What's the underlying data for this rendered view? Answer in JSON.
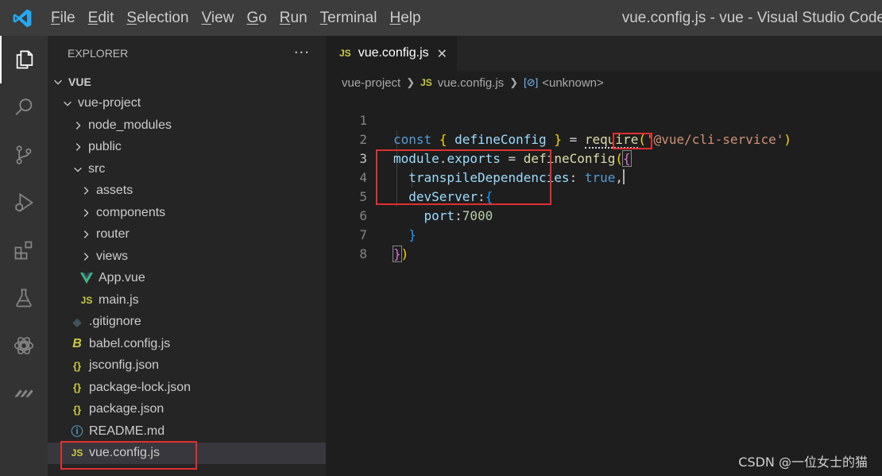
{
  "window": {
    "title": "vue.config.js - vue - Visual Studio Code",
    "menu": [
      {
        "first": "F",
        "rest": "ile"
      },
      {
        "first": "E",
        "rest": "dit"
      },
      {
        "first": "S",
        "rest": "election"
      },
      {
        "first": "V",
        "rest": "iew"
      },
      {
        "first": "G",
        "rest": "o"
      },
      {
        "first": "R",
        "rest": "un"
      },
      {
        "first": "T",
        "rest": "erminal"
      },
      {
        "first": "H",
        "rest": "elp"
      }
    ]
  },
  "activity_bar": [
    "explorer-icon",
    "search-icon",
    "source-control-icon",
    "run-debug-icon",
    "extensions-icon",
    "testing-icon",
    "chatgpt-icon",
    "remote-icon"
  ],
  "explorer": {
    "title": "EXPLORER",
    "more": "···",
    "root": "VUE",
    "items": [
      {
        "label": "vue-project",
        "type": "folder-open"
      },
      {
        "label": "node_modules",
        "type": "folder"
      },
      {
        "label": "public",
        "type": "folder"
      },
      {
        "label": "src",
        "type": "folder-open"
      },
      {
        "label": "assets",
        "type": "folder"
      },
      {
        "label": "components",
        "type": "folder"
      },
      {
        "label": "router",
        "type": "folder"
      },
      {
        "label": "views",
        "type": "folder"
      },
      {
        "label": "App.vue",
        "type": "vue",
        "icon": "V"
      },
      {
        "label": "main.js",
        "type": "js",
        "icon": "JS"
      },
      {
        "label": ".gitignore",
        "type": "git",
        "icon": "◆"
      },
      {
        "label": "babel.config.js",
        "type": "babel",
        "icon": "B"
      },
      {
        "label": "jsconfig.json",
        "type": "json",
        "icon": "{}"
      },
      {
        "label": "package-lock.json",
        "type": "json",
        "icon": "{}"
      },
      {
        "label": "package.json",
        "type": "json",
        "icon": "{}"
      },
      {
        "label": "README.md",
        "type": "info",
        "icon": "ⓘ"
      },
      {
        "label": "vue.config.js",
        "type": "js",
        "icon": "JS",
        "selected": true
      }
    ]
  },
  "editor": {
    "tab": {
      "icon": "JS",
      "label": "vue.config.js",
      "close": "✕"
    },
    "breadcrumbs": {
      "folder": "vue-project",
      "file_icon": "JS",
      "file": "vue.config.js",
      "symbol_icon": "[⊘]",
      "symbol": "<unknown>"
    },
    "line_numbers": [
      "1",
      "2",
      "3",
      "4",
      "5",
      "6",
      "7",
      "8"
    ],
    "code": {
      "l1": {
        "const": "const",
        "lb": "{",
        "name": "defineConfig",
        "rb": "}",
        "eq": "=",
        "require": "require",
        "lp": "(",
        "str": "'@vue/cli-service'",
        "rp": ")"
      },
      "l2": {
        "module": "module",
        "dot": ".",
        "exports": "exports",
        "eq": "=",
        "fn": "defineConfig",
        "lp": "(",
        "lb": "{"
      },
      "l3": {
        "key": "transpileDependencies",
        "colon": ":",
        "val": "true",
        "comma": ","
      },
      "l4": {
        "key": "devServer",
        "colon": ":",
        "lb": "{"
      },
      "l5": {
        "key": "port",
        "colon": ":",
        "val": "7000"
      },
      "l6": {
        "rb": "}"
      },
      "l7": {
        "rb": "}",
        "rp": ")"
      }
    }
  },
  "watermark": "CSDN @一位女士的猫"
}
